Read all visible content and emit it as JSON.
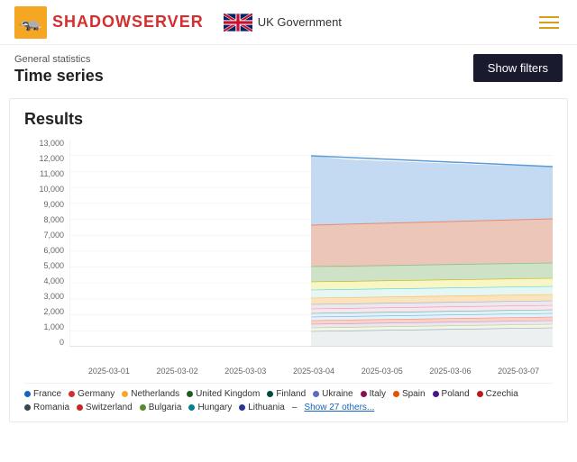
{
  "header": {
    "logo_text_shadow": "SHADOW",
    "logo_text_server": "SERVER",
    "uk_gov_label": "UK Government",
    "hamburger_icon": "menu-icon"
  },
  "page": {
    "breadcrumb": "General statistics",
    "title": "Time series",
    "show_filters_label": "Show filters"
  },
  "chart": {
    "results_label": "Results",
    "y_labels": [
      "13,000",
      "12,000",
      "11,000",
      "10,000",
      "9,000",
      "8,000",
      "7,000",
      "6,000",
      "5,000",
      "4,000",
      "3,000",
      "2,000",
      "1,000",
      "0"
    ],
    "x_labels": [
      "2025-03-01",
      "2025-03-02",
      "2025-03-03",
      "2025-03-04",
      "2025-03-05",
      "2025-03-06",
      "2025-03-07"
    ]
  },
  "legend": {
    "items": [
      {
        "label": "France",
        "color": "#1565c0"
      },
      {
        "label": "Germany",
        "color": "#d32f2f"
      },
      {
        "label": "Netherlands",
        "color": "#f9a825"
      },
      {
        "label": "United Kingdom",
        "color": "#1b5e20"
      },
      {
        "label": "Finland",
        "color": "#004d40"
      },
      {
        "label": "Ukraine",
        "color": "#1565c0"
      },
      {
        "label": "Italy",
        "color": "#880e4f"
      },
      {
        "label": "Spain",
        "color": "#e65100"
      },
      {
        "label": "Poland",
        "color": "#4a148c"
      },
      {
        "label": "Czechia",
        "color": "#b71c1c"
      },
      {
        "label": "Romania",
        "color": "#37474f"
      },
      {
        "label": "Switzerland",
        "color": "#c62828"
      },
      {
        "label": "Bulgaria",
        "color": "#558b2f"
      },
      {
        "label": "Hungary",
        "color": "#00838f"
      },
      {
        "label": "Lithuania",
        "color": "#283593"
      }
    ],
    "show_others_label": "Show 27 others..."
  }
}
